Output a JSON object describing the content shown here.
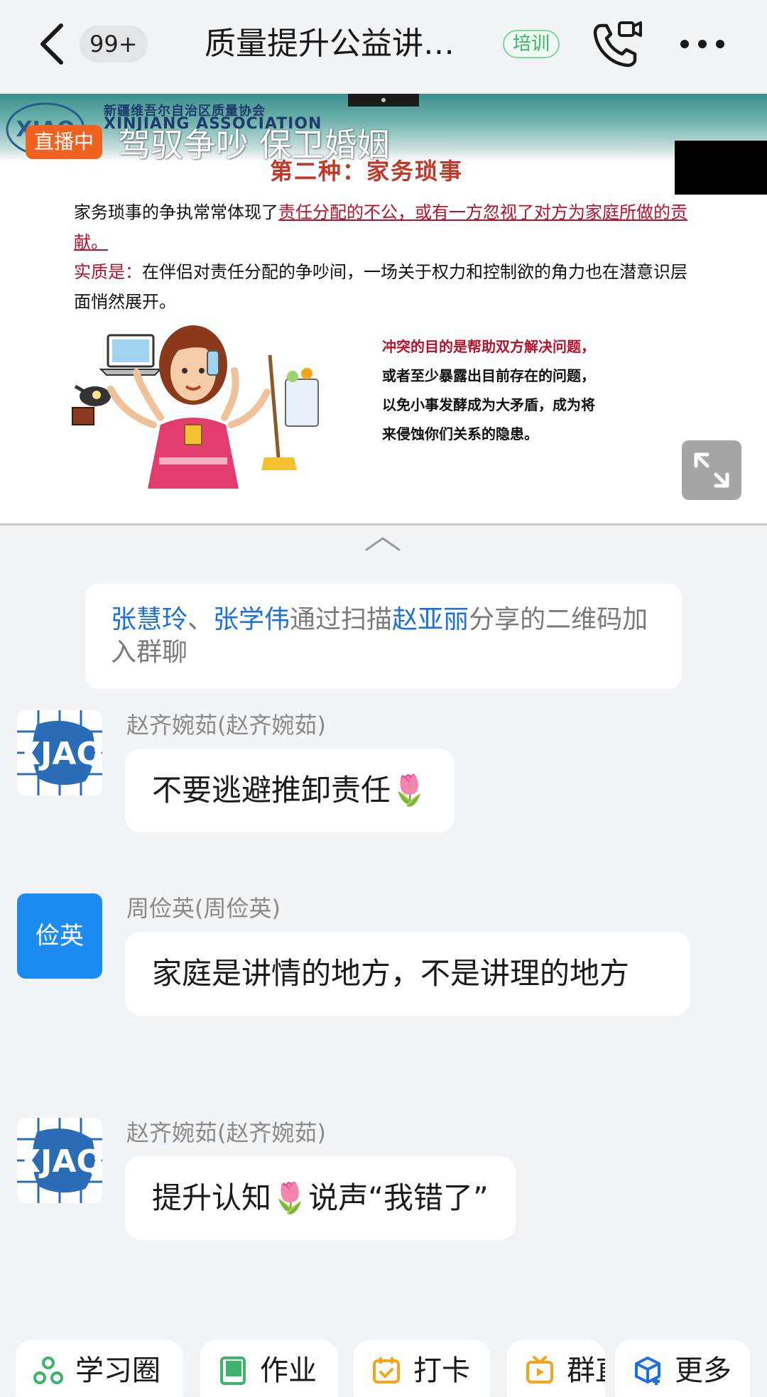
{
  "header": {
    "back_icon": "chevron-left-icon",
    "unread_badge": "99+",
    "title": "质量提升公益讲…",
    "tag": "培训",
    "call_icon": "phone-video-icon",
    "more_icon": "more-dots-icon"
  },
  "live": {
    "badge": "直播中",
    "title": "驾驭争吵  保卫婚姻",
    "slide": {
      "org_cn": "新疆维吾尔自治区质量协会",
      "org_en": "XINJIANG ASSOCIATION",
      "heading": "第二种：家务琐事",
      "p1_plain": "家务琐事的争执常常体现了",
      "p1_red": "责任分配的不公，或有一方忽视了对方为家庭所做的贡献。",
      "p2_label": "实质是：",
      "p2_text": "在伴侣对责任分配的争吵间，一场关于权力和控制欲的角力也在潜意识层面悄然展开。",
      "side_red": "冲突的目的是帮助双方解决问题，",
      "side_black": "或者至少暴露出目前存在的问题，以免小事发酵成为大矛盾，成为将来侵蚀你们关系的隐患。"
    },
    "expand_icon": "expand-icon",
    "collapse_icon": "chevron-up-icon"
  },
  "notice": {
    "name1": "张慧玲",
    "sep": "、",
    "name2": "张学伟",
    "mid": "通过扫描",
    "name3": "赵亚丽",
    "tail": "分享的二维码加入群聊"
  },
  "messages": [
    {
      "sender": "赵齐婉茹(赵齐婉茹)",
      "text": "不要逃避推卸责任🌷"
    },
    {
      "sender": "周俭英(周俭英)",
      "avatar_text": "俭英",
      "text": "家庭是讲情的地方，不是讲理的地方"
    },
    {
      "sender": "赵齐婉茹(赵齐婉茹)",
      "text": "提升认知🌷说声“我错了”"
    }
  ],
  "toolbar": {
    "items": [
      {
        "label": "学习圈",
        "icon": "learning-circle-icon",
        "color": "#3fb36b"
      },
      {
        "label": "作业",
        "icon": "homework-icon",
        "color": "#3fb36b"
      },
      {
        "label": "打卡",
        "icon": "checkin-icon",
        "color": "#f2a51d"
      },
      {
        "label": "群直",
        "icon": "group-live-icon",
        "color": "#f2a51d"
      },
      {
        "label": "更多",
        "icon": "more-cube-icon",
        "color": "#1e6fd9"
      }
    ]
  }
}
